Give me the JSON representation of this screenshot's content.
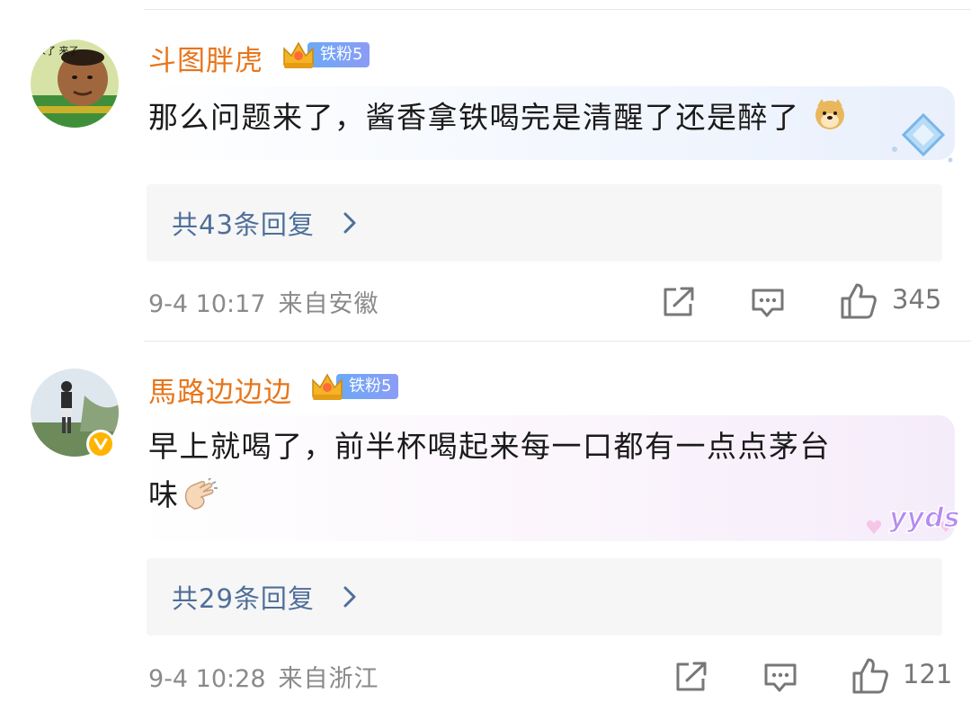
{
  "comments": [
    {
      "username": "斗图胖虎",
      "fan_badge": "铁粉5",
      "avatar_text": "来了 来了",
      "text": "那么问题来了，酱香拿铁喝完是清醒了还是醉了",
      "replies_label": "共43条回复",
      "timestamp": "9-4 10:17",
      "location": "来自安徽",
      "likes": "345",
      "verified": false
    },
    {
      "username": "馬路边边边",
      "fan_badge": "铁粉5",
      "text_line1": "早上就喝了，前半杯喝起来每一口都有一点点茅台",
      "text_line2": "味",
      "replies_label": "共29条回复",
      "timestamp": "9-4 10:28",
      "location": "来自浙江",
      "likes": "121",
      "verified": true,
      "sticker_text": "yyds"
    }
  ],
  "icons": {
    "share": "share-icon",
    "comment": "comment-icon",
    "like": "thumbs-up-icon",
    "chevron": "chevron-right-icon",
    "crown": "crown-icon",
    "doge_emoji": "doge-emoji-icon",
    "clap_emoji": "clap-emoji-icon",
    "verified": "verified-badge-icon"
  },
  "colors": {
    "username": "#e8751a",
    "replies_link": "#4e6f9a",
    "meta": "#8a8a8a",
    "fan_badge": "#6aa9f6",
    "verified_badge": "#ffb400"
  }
}
